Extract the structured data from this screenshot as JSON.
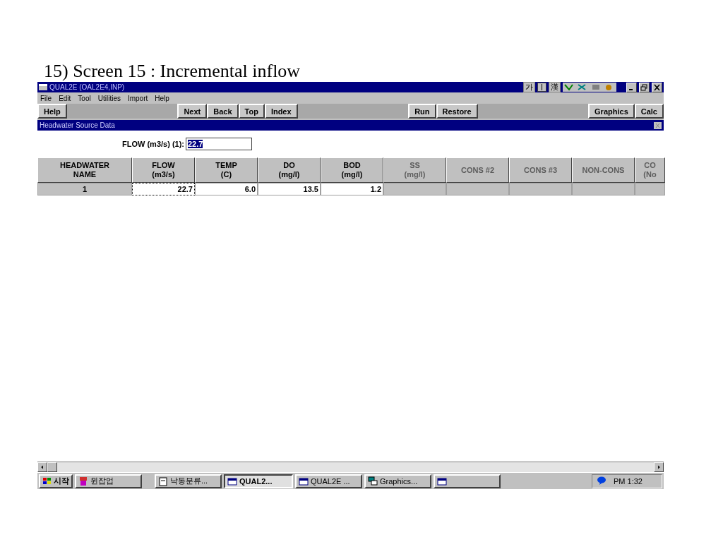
{
  "caption": "15) Screen 15 : Incremental inflow",
  "window": {
    "title": "QUAL2E (OAL2E4,INP)",
    "ime": [
      "가",
      "漢"
    ]
  },
  "menu": [
    {
      "label": "File"
    },
    {
      "label": "Edit"
    },
    {
      "label": "Tool"
    },
    {
      "label": "Utilities"
    },
    {
      "label": "Import"
    },
    {
      "label": "Help"
    }
  ],
  "toolbar": [
    {
      "kind": "button",
      "label": "Help"
    },
    {
      "kind": "spacer"
    },
    {
      "kind": "button",
      "label": "Next"
    },
    {
      "kind": "button",
      "label": "Back"
    },
    {
      "kind": "button",
      "label": "Top"
    },
    {
      "kind": "button",
      "label": "Index"
    },
    {
      "kind": "spacer"
    },
    {
      "kind": "button",
      "label": "Run"
    },
    {
      "kind": "button",
      "label": "Restore"
    },
    {
      "kind": "spacer"
    },
    {
      "kind": "button",
      "label": "Graphics"
    },
    {
      "kind": "button",
      "label": "Calc"
    }
  ],
  "panel": {
    "title": "Headwater Source Data"
  },
  "flow_field": {
    "label": "FLOW (m3/s) (1):",
    "value": "22.7",
    "highlighted": true
  },
  "table": {
    "columns": [
      {
        "lines": [
          "HEADWATER",
          "NAME"
        ],
        "disabled": false
      },
      {
        "lines": [
          "FLOW",
          "(m3/s)"
        ],
        "disabled": false
      },
      {
        "lines": [
          "TEMP",
          "(C)"
        ],
        "disabled": false
      },
      {
        "lines": [
          "DO",
          "(mg/l)"
        ],
        "disabled": false
      },
      {
        "lines": [
          "BOD",
          "(mg/l)"
        ],
        "disabled": false
      },
      {
        "lines": [
          "SS",
          "(mg/l)"
        ],
        "disabled": true
      },
      {
        "lines": [
          "CONS #2"
        ],
        "disabled": true
      },
      {
        "lines": [
          "CONS #3"
        ],
        "disabled": true
      },
      {
        "lines": [
          "NON-CONS"
        ],
        "disabled": true
      },
      {
        "lines": [
          "CO",
          "(No"
        ],
        "disabled": true
      }
    ],
    "rows": [
      {
        "cells": [
          {
            "text": "1",
            "focused": false
          },
          {
            "text": "22.7",
            "focused": true
          },
          {
            "text": "6.0",
            "focused": false
          },
          {
            "text": "13.5",
            "focused": false
          },
          {
            "text": "1.2",
            "focused": false
          }
        ]
      }
    ]
  },
  "taskbar": {
    "start": "시작",
    "tasks": [
      {
        "label": "윈잡업",
        "kind": "app",
        "selected": false
      },
      {
        "label": "낙동분류...",
        "kind": "doc",
        "selected": false
      },
      {
        "label": "QUAL2...",
        "kind": "window",
        "selected": true
      },
      {
        "label": "QUAL2E ...",
        "kind": "window",
        "selected": false
      },
      {
        "label": "Graphics...",
        "kind": "graphics",
        "selected": false
      },
      {
        "kind": "window",
        "selected": false
      }
    ],
    "clock": "PM 1:32"
  }
}
